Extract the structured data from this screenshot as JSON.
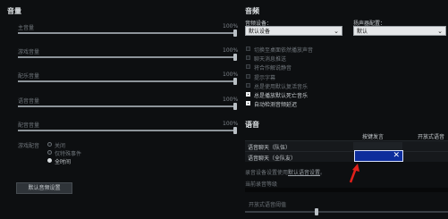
{
  "left": {
    "title": "音量",
    "sliders": [
      {
        "label": "主音量",
        "value": "100%",
        "level": 1.0
      },
      {
        "label": "游戏音量",
        "value": "100%",
        "level": 1.0
      },
      {
        "label": "配乐音量",
        "value": "100%",
        "level": 1.0
      },
      {
        "label": "语音音量",
        "value": "100%",
        "level": 1.0
      },
      {
        "label": "配音音量",
        "value": "100%",
        "level": 1.0
      }
    ],
    "game_voice": {
      "label": "游戏配音",
      "options": [
        {
          "label": "关闭",
          "selected": false
        },
        {
          "label": "仅特殊事件",
          "selected": false
        },
        {
          "label": "全时间",
          "selected": true
        }
      ]
    },
    "reset_button": "默认音频设置"
  },
  "right": {
    "title": "音频",
    "device": {
      "label": "音频设备：",
      "value": "默认设备"
    },
    "speaker": {
      "label": "扬声器配置：",
      "value": "默认"
    },
    "checkboxes": [
      {
        "label": "切换至桌面依然播放声音",
        "checked": false
      },
      {
        "label": "聊天消息推送",
        "checked": false
      },
      {
        "label": "将合作解说静音",
        "checked": false
      },
      {
        "label": "提示字幕",
        "checked": false
      },
      {
        "label": "总是使用默认复活音乐",
        "checked": false
      },
      {
        "label": "总是播放默认死亡音乐",
        "checked": true
      },
      {
        "label": "自动检测音频延迟",
        "checked": true
      }
    ],
    "voice": {
      "title": "语音",
      "columns": [
        "按键发言",
        "开放式语音"
      ],
      "rows": [
        {
          "label": "语音聊天（队伍）"
        },
        {
          "label": "语音聊天（全队友）"
        }
      ],
      "clear_icon": "close-icon",
      "settings_note_prefix": "录音设备设置使用",
      "settings_note_link": "默认语音设置",
      "settings_note_suffix": "。",
      "current_level_label": "当前录音等级",
      "threshold_label": "开放式语音阈值"
    },
    "annotation_color": "#e0201b"
  }
}
